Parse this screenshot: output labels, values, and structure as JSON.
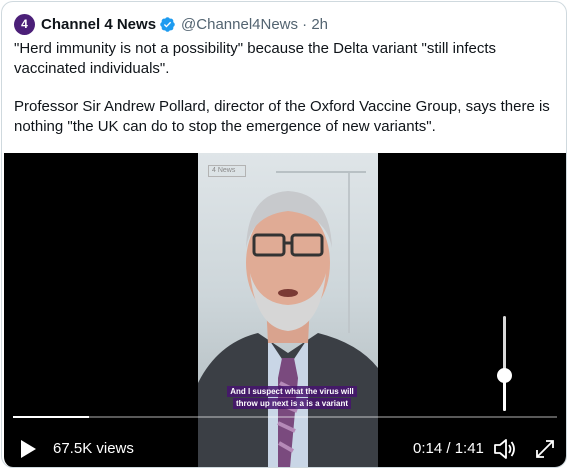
{
  "author": {
    "avatar_glyph": "4",
    "display_name": "Channel 4 News",
    "handle_time": "@Channel4News · 2h"
  },
  "tweet": {
    "paragraph1": "\"Herd immunity is not a possibility\" because the Delta variant \"still infects vaccinated individuals\".",
    "paragraph2": "Professor Sir Andrew Pollard, director of the Oxford Vaccine Group, says there is nothing \"the UK can do to stop the emergence of new variants\"."
  },
  "video": {
    "logo_bug": "4 News",
    "caption_line1": "And I suspect what the virus will",
    "caption_line2": "throw up next is a is a variant",
    "views": "67.5K views",
    "time": "0:14 / 1:41",
    "progress": 0.14,
    "volume": 0.37
  },
  "colors": {
    "verified": "#1d9bf0",
    "avatar_bg": "#4b1f78",
    "caption_bg": "#46146e"
  },
  "icons": {
    "play": "play-icon",
    "volume": "volume-icon",
    "fullscreen": "fullscreen-icon",
    "verified": "verified-badge-icon"
  }
}
